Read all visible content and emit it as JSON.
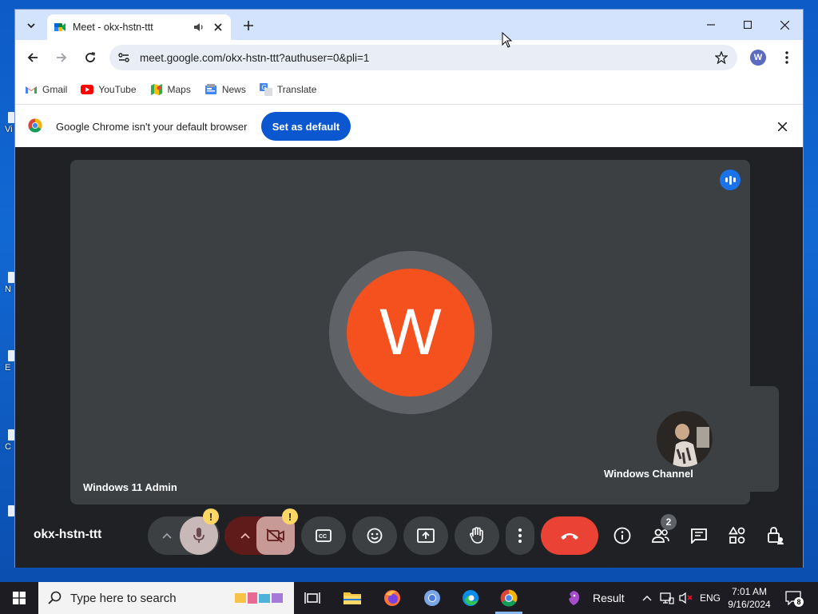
{
  "desktop": {
    "icon_labels": [
      "Vi",
      "N",
      "E",
      "C"
    ]
  },
  "browser": {
    "tab": {
      "title": "Meet - okx-hstn-ttt"
    },
    "url": "meet.google.com/okx-hstn-ttt?authuser=0&pli=1",
    "profile_initial": "W",
    "bookmarks": [
      {
        "label": "Gmail",
        "icon": "gmail-icon"
      },
      {
        "label": "YouTube",
        "icon": "youtube-icon"
      },
      {
        "label": "Maps",
        "icon": "maps-icon"
      },
      {
        "label": "News",
        "icon": "news-icon"
      },
      {
        "label": "Translate",
        "icon": "translate-icon"
      }
    ],
    "infobar": {
      "message": "Google Chrome isn't your default browser",
      "button_label": "Set as default"
    }
  },
  "meet": {
    "main_tile": {
      "initial": "W",
      "name": "Windows 11 Admin",
      "avatar_color": "#f4511e"
    },
    "self_tile": {
      "name": "Windows Channel"
    },
    "meeting_code": "okx-hstn-ttt",
    "people_count": "2",
    "warn_mark": "!"
  },
  "taskbar": {
    "search_placeholder": "Type here to search",
    "result_label": "Result",
    "language": "ENG",
    "time": "7:01 AM",
    "date": "9/16/2024",
    "notification_count": "8"
  },
  "colors": {
    "accent": "#0b57d0",
    "hangup": "#ea4335",
    "warning": "#fdd663",
    "meet_bg": "#202124",
    "tile_bg": "#3c4043"
  }
}
